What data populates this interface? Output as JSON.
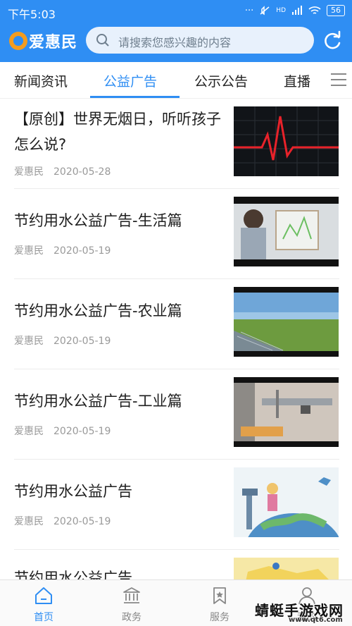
{
  "status_bar": {
    "time": "下午5:03",
    "indicators": "··· ",
    "network": "HD",
    "battery": "56"
  },
  "header": {
    "brand": "爱惠民",
    "search_placeholder": "请搜索您感兴趣的内容",
    "colors": {
      "primary": "#2f8ef3",
      "logo_orange": "#f39c1f"
    }
  },
  "tabs": [
    {
      "label": "新闻资讯",
      "active": false
    },
    {
      "label": "公益广告",
      "active": true
    },
    {
      "label": "公示公告",
      "active": false
    },
    {
      "label": "直播",
      "active": false
    }
  ],
  "news": [
    {
      "title": "【原创】世界无烟日，听听孩子怎么说?",
      "source": "爱惠民",
      "date": "2020-05-28",
      "thumb": "heartbeat-monitor-image"
    },
    {
      "title": "节约用水公益广告-生活篇",
      "source": "爱惠民",
      "date": "2020-05-19",
      "thumb": "boy-looking-at-painting-image"
    },
    {
      "title": "节约用水公益广告-农业篇",
      "source": "爱惠民",
      "date": "2020-05-19",
      "thumb": "farmland-sky-image"
    },
    {
      "title": "节约用水公益广告-工业篇",
      "source": "爱惠民",
      "date": "2020-05-19",
      "thumb": "water-faucet-image"
    },
    {
      "title": "节约用水公益广告",
      "source": "爱惠民",
      "date": "2020-05-19",
      "thumb": "cartoon-earth-tap-image"
    },
    {
      "title": "节约用水公益广告",
      "source": "",
      "date": "",
      "thumb": "map-image"
    }
  ],
  "bottom_nav": [
    {
      "label": "首页",
      "icon": "home-icon",
      "active": true
    },
    {
      "label": "政务",
      "icon": "government-icon",
      "active": false
    },
    {
      "label": "服务",
      "icon": "service-bookmark-icon",
      "active": false
    },
    {
      "label": "我的",
      "icon": "user-icon",
      "active": false
    }
  ],
  "watermark": {
    "text": "蜻蜓手游戏网",
    "url": "www.qt6.com"
  }
}
